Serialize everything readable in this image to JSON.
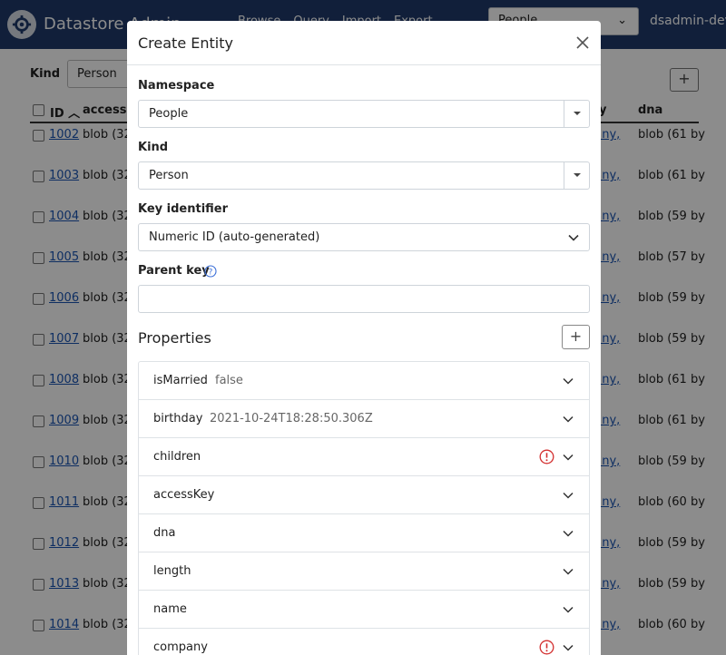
{
  "app": {
    "title": "Datastore Admin",
    "nav": [
      "Browse",
      "Query",
      "Import",
      "Export"
    ],
    "namespace_selected": "People",
    "user": "dsadmin-dev"
  },
  "background": {
    "kind_label": "Kind",
    "kind_value": "Person",
    "add_button": "+",
    "columns": {
      "id": "ID",
      "sort_indicator": "︿",
      "accesskey": "accessK",
      "company": "y",
      "dna": "dna"
    },
    "rows": [
      {
        "id": "1002",
        "blob": "blob (32",
        "company": "pany,",
        "dna": "blob (61 by"
      },
      {
        "id": "1003",
        "blob": "blob (32",
        "company": "pany,",
        "dna": "blob (61 by"
      },
      {
        "id": "1004",
        "blob": "blob (32",
        "company": "pany,",
        "dna": "blob (59 by"
      },
      {
        "id": "1005",
        "blob": "blob (32",
        "company": "pany,",
        "dna": "blob (57 by"
      },
      {
        "id": "1006",
        "blob": "blob (32",
        "company": "pany,",
        "dna": "blob (59 by"
      },
      {
        "id": "1007",
        "blob": "blob (32",
        "company": "pany,",
        "dna": "blob (59 by"
      },
      {
        "id": "1008",
        "blob": "blob (32",
        "company": "pany,",
        "dna": "blob (61 by"
      },
      {
        "id": "1009",
        "blob": "blob (32",
        "company": "pany,",
        "dna": "blob (61 by"
      },
      {
        "id": "1010",
        "blob": "blob (32",
        "company": "pany,",
        "dna": "blob (59 by"
      },
      {
        "id": "1011",
        "blob": "blob (32",
        "company": "pany,",
        "dna": "blob (60 by"
      },
      {
        "id": "1012",
        "blob": "blob (32",
        "company": "pany,",
        "dna": "blob (59 by"
      },
      {
        "id": "1013",
        "blob": "blob (32",
        "company": "pany,",
        "dna": "blob (59 by"
      },
      {
        "id": "1014",
        "blob": "blob (32",
        "company": "pany,",
        "dna": "blob (60 by"
      }
    ]
  },
  "modal": {
    "title": "Create Entity",
    "namespace_label": "Namespace",
    "namespace_value": "People",
    "kind_label": "Kind",
    "kind_value": "Person",
    "key_label": "Key identifier",
    "key_value": "Numeric ID (auto-generated)",
    "parent_label": "Parent key",
    "parent_value": "",
    "properties_title": "Properties",
    "add_property": "+",
    "properties": [
      {
        "name": "isMarried",
        "value": "false",
        "warning": false
      },
      {
        "name": "birthday",
        "value": "2021-10-24T18:28:50.306Z",
        "warning": false
      },
      {
        "name": "children",
        "value": "",
        "warning": true
      },
      {
        "name": "accessKey",
        "value": "",
        "warning": false
      },
      {
        "name": "dna",
        "value": "",
        "warning": false
      },
      {
        "name": "length",
        "value": "",
        "warning": false
      },
      {
        "name": "name",
        "value": "",
        "warning": false
      },
      {
        "name": "company",
        "value": "",
        "warning": true
      }
    ]
  },
  "colors": {
    "header_bg": "#1f3a6b",
    "link": "#1a55b3",
    "warning": "#d32f2f",
    "help": "#3b6fd8"
  }
}
